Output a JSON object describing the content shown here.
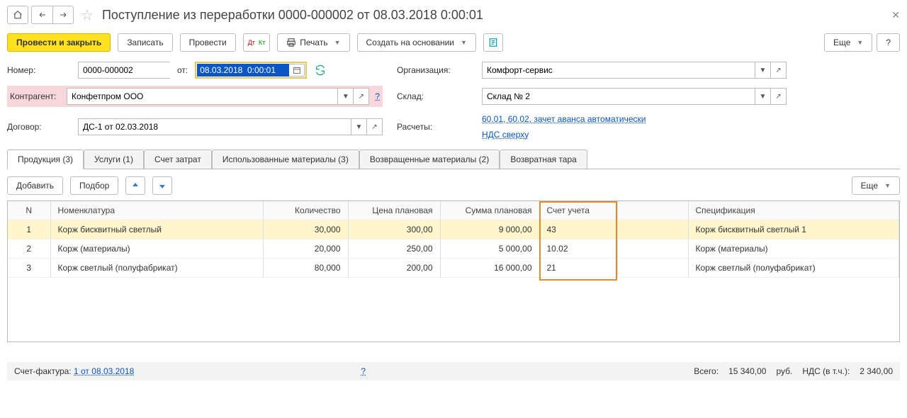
{
  "title": "Поступление из переработки 0000-000002 от 08.03.2018 0:00:01",
  "toolbar": {
    "post_close": "Провести и закрыть",
    "write": "Записать",
    "post": "Провести",
    "print": "Печать",
    "create_based": "Создать на основании",
    "more": "Еще",
    "help": "?"
  },
  "form": {
    "number_lbl": "Номер:",
    "number": "0000-000002",
    "from_lbl": "от:",
    "date": "08.03.2018  0:00:01",
    "org_lbl": "Организация:",
    "org": "Комфорт-сервис",
    "kontr_lbl": "Контрагент:",
    "kontr": "Конфетпром ООО",
    "sklad_lbl": "Склад:",
    "sklad": "Склад № 2",
    "dog_lbl": "Договор:",
    "dog": "ДС-1 от 02.03.2018",
    "calc_lbl": "Расчеты:",
    "calc_link": "60.01, 60.02, зачет аванса автоматически",
    "vat_link": "НДС сверху",
    "q": "?"
  },
  "tabs": [
    "Продукция (3)",
    "Услуги (1)",
    "Счет затрат",
    "Использованные материалы (3)",
    "Возвращенные материалы (2)",
    "Возвратная тара"
  ],
  "tabtools": {
    "add": "Добавить",
    "pick": "Подбор",
    "more": "Еще"
  },
  "table": {
    "headers": [
      "N",
      "Номенклатура",
      "Количество",
      "Цена плановая",
      "Сумма плановая",
      "Счет учета",
      "Спецификация"
    ],
    "rows": [
      {
        "n": "1",
        "nom": "Корж бисквитный светлый",
        "qty": "30,000",
        "price": "300,00",
        "sum": "9 000,00",
        "acct": "43",
        "spec": "Корж бисквитный светлый 1"
      },
      {
        "n": "2",
        "nom": "Корж (материалы)",
        "qty": "20,000",
        "price": "250,00",
        "sum": "5 000,00",
        "acct": "10.02",
        "spec": "Корж (материалы)"
      },
      {
        "n": "3",
        "nom": "Корж светлый (полуфабрикат)",
        "qty": "80,000",
        "price": "200,00",
        "sum": "16 000,00",
        "acct": "21",
        "spec": "Корж светлый (полуфабрикат)"
      }
    ]
  },
  "footer": {
    "sf_lbl": "Счет-фактура:",
    "sf_link": "1 от 08.03.2018",
    "q": "?",
    "total_lbl": "Всего:",
    "total": "15 340,00",
    "cur": "руб.",
    "vat_lbl": "НДС (в т.ч.):",
    "vat": "2 340,00"
  }
}
